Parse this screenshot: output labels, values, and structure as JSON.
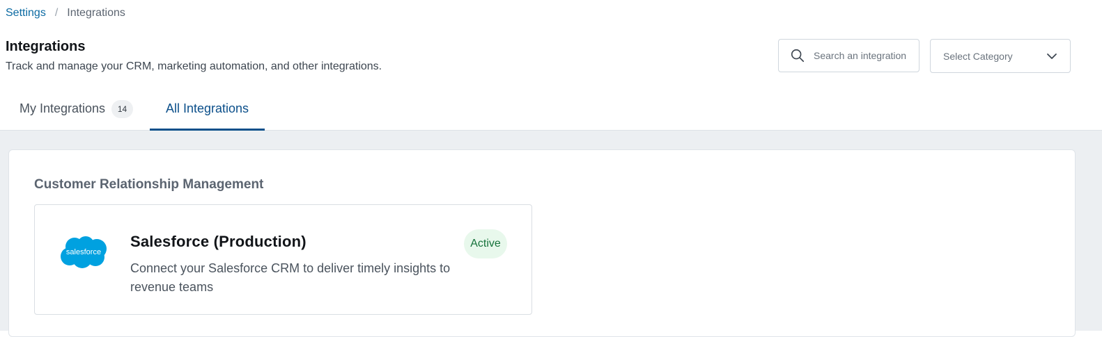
{
  "breadcrumb": {
    "parent": "Settings",
    "separator": "/",
    "current": "Integrations"
  },
  "header": {
    "title": "Integrations",
    "subtitle": "Track and manage your CRM, marketing automation, and other integrations."
  },
  "search": {
    "placeholder": "Search an integration",
    "icon": "search-icon"
  },
  "category_select": {
    "selected": "Select Category",
    "icon": "chevron-down-icon"
  },
  "tabs": [
    {
      "label": "My Integrations",
      "count": "14",
      "active": false
    },
    {
      "label": "All Integrations",
      "active": true
    }
  ],
  "sections": [
    {
      "title": "Customer Relationship Management",
      "cards": [
        {
          "logo_text": "salesforce",
          "name": "Salesforce (Production)",
          "description": "Connect your Salesforce CRM to deliver timely insights to revenue teams",
          "status": "Active"
        }
      ]
    }
  ],
  "colors": {
    "accent": "#0b4f8a",
    "link": "#0b6aa2",
    "active_badge_bg": "#e8f8ec",
    "active_badge_text": "#16733b",
    "salesforce_blue": "#00a1e0",
    "content_bg": "#eceff2"
  }
}
